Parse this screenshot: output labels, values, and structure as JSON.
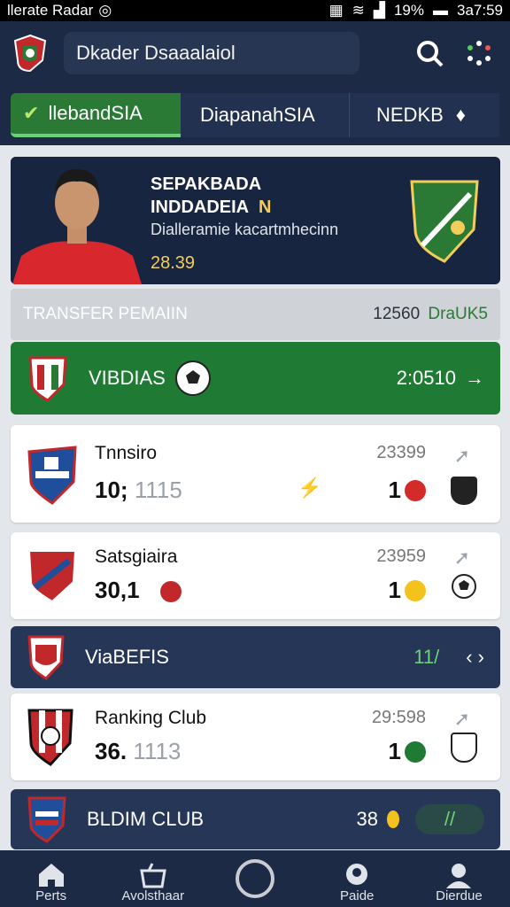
{
  "status": {
    "app_label": "llerate Radar",
    "battery": "19%",
    "clock": "3a7:59"
  },
  "header": {
    "search_text": "Dkader Dsaaalaiol"
  },
  "tabs": [
    {
      "label": "llebandSIA"
    },
    {
      "label": "DiapanahSIA"
    },
    {
      "label": "NEDKB"
    }
  ],
  "hero": {
    "name_line1": "SEPAKBADA",
    "name_line2": "INDDADEIA",
    "name_suffix": "N",
    "subtitle": "Dialleramie kacartmhecinn",
    "value": "28.39"
  },
  "section": {
    "title": "TRANSFER PEMAIIN",
    "right_text": "12560",
    "right_accent": "DraUK5"
  },
  "leagues": [
    {
      "name": "VIBDIAS",
      "value": "2:0510"
    },
    {
      "name": "ViaBEFIS",
      "value": "11/"
    },
    {
      "name": "BLDIM CLUB",
      "value": "38"
    }
  ],
  "cards": [
    {
      "name": "Tnnsiro",
      "score_main": "10;",
      "score_muted": "1115",
      "time": "23399",
      "count": "1"
    },
    {
      "name": "Satsgiaira",
      "score_main": "30,1",
      "score_muted": "",
      "time": "23959",
      "count": "1"
    },
    {
      "name": "Ranking Club",
      "score_main": "36.",
      "score_muted": "1113",
      "time": "29:598",
      "count": "1"
    }
  ],
  "bottom_nav": [
    {
      "label": "Perts",
      "icon": "home-icon"
    },
    {
      "label": "Avolsthaar",
      "icon": "basket-icon"
    },
    {
      "label": "",
      "icon": "circle-icon"
    },
    {
      "label": "Paide",
      "icon": "user-icon"
    },
    {
      "label": "Dierdue",
      "icon": "profile-icon"
    }
  ],
  "colors": {
    "navy": "#1d2a45",
    "green": "#1f7a34",
    "accent_gold": "#f3cd5a"
  }
}
